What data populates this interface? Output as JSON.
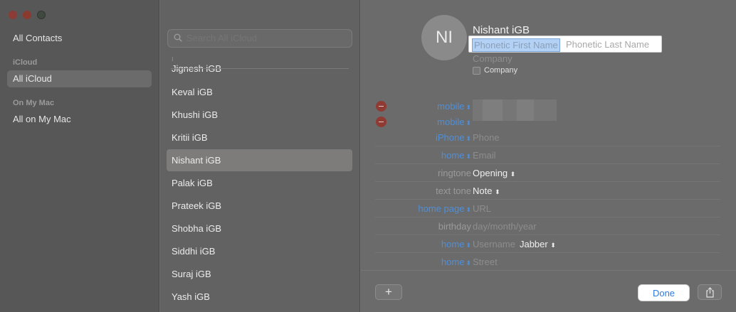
{
  "sidebar": {
    "all_contacts": "All Contacts",
    "icloud_header": "iCloud",
    "all_icloud": "All iCloud",
    "on_my_mac_header": "On My Mac",
    "all_on_my_mac": "All on My Mac"
  },
  "list": {
    "search_placeholder": "Search All iCloud",
    "section_letter": "I",
    "contacts": [
      "Jignesh iGB",
      "Keval iGB",
      "Khushi iGB",
      "Kritii iGB",
      "Nishant iGB",
      "Palak iGB",
      "Prateek iGB",
      "Shobha iGB",
      "Siddhi iGB",
      "Suraj iGB",
      "Yash iGB"
    ],
    "selected_index": 4
  },
  "detail": {
    "initials": "NI",
    "name": "Nishant  iGB",
    "phonetic_first_placeholder": "Phonetic First Name",
    "phonetic_last_placeholder": "Phonetic Last Name",
    "company_placeholder": "Company",
    "company_checkbox_label": "Company",
    "fields": [
      {
        "label": "mobile",
        "value": "",
        "placeholder": ""
      },
      {
        "label": "mobile",
        "value": "",
        "placeholder": ""
      },
      {
        "label": "iPhone",
        "value": "",
        "placeholder": "Phone"
      },
      {
        "label": "home",
        "value": "",
        "placeholder": "Email"
      },
      {
        "label": "ringtone",
        "value": "Opening",
        "placeholder": ""
      },
      {
        "label": "text tone",
        "value": "Note",
        "placeholder": ""
      },
      {
        "label": "home page",
        "value": "",
        "placeholder": "URL"
      },
      {
        "label": "birthday",
        "value": "",
        "placeholder": "day/month/year"
      },
      {
        "label": "home",
        "value": "",
        "placeholder": "Username",
        "extra": "Jabber"
      },
      {
        "label": "home",
        "value": "",
        "placeholder": "Street"
      }
    ],
    "add_button": "+",
    "done_button": "Done"
  },
  "colors": {
    "accent": "#4f8fd8",
    "done_text": "#2d7ae0",
    "remove_red": "#8f3a32"
  }
}
